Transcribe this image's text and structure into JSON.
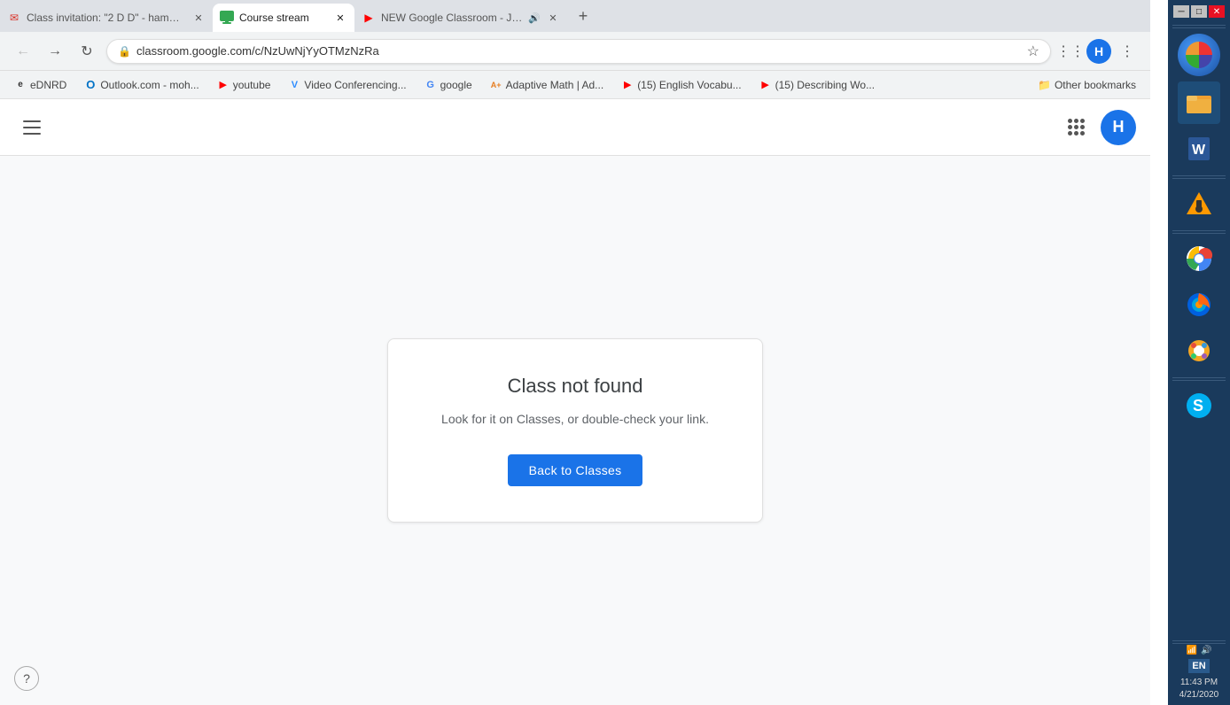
{
  "browser": {
    "tabs": [
      {
        "id": "tab1",
        "favicon": "✉",
        "favicon_color": "#d93025",
        "label": "Class invitation: \"2 D D\" - hamm...",
        "active": false,
        "audio": false
      },
      {
        "id": "tab2",
        "favicon": "📋",
        "favicon_color": "#34a853",
        "label": "Course stream",
        "active": true,
        "audio": false
      },
      {
        "id": "tab3",
        "favicon": "▶",
        "favicon_color": "#ff0000",
        "label": "NEW Google Classroom - Jo...",
        "active": false,
        "audio": true
      }
    ],
    "url": "classroom.google.com/c/NzUwNjYyOTMzNzRa",
    "url_display": "classroom.google.com/c/NzUwNjYyOTMzNzRa"
  },
  "bookmarks": [
    {
      "id": "bm1",
      "favicon": "📧",
      "label": "eDNRD"
    },
    {
      "id": "bm2",
      "favicon": "O",
      "label": "Outlook.com - moh..."
    },
    {
      "id": "bm3",
      "favicon": "▶",
      "label": "youtube"
    },
    {
      "id": "bm4",
      "favicon": "V",
      "label": "Video Conferencing..."
    },
    {
      "id": "bm5",
      "favicon": "G",
      "label": "google"
    },
    {
      "id": "bm6",
      "favicon": "A+",
      "label": "Adaptive Math | Ad..."
    },
    {
      "id": "bm7",
      "favicon": "▶",
      "label": "(15) English Vocabu..."
    },
    {
      "id": "bm8",
      "favicon": "▶",
      "label": "(15) Describing Wo..."
    }
  ],
  "bookmarks_other_label": "Other bookmarks",
  "page": {
    "error_title": "Class not found",
    "error_subtitle": "Look for it on Classes, or double-check your link.",
    "back_button_label": "Back to Classes"
  },
  "header": {
    "profile_letter": "H"
  },
  "taskbar": {
    "lang": "EN",
    "time": "11:43 PM",
    "date": "4/21/2020"
  }
}
